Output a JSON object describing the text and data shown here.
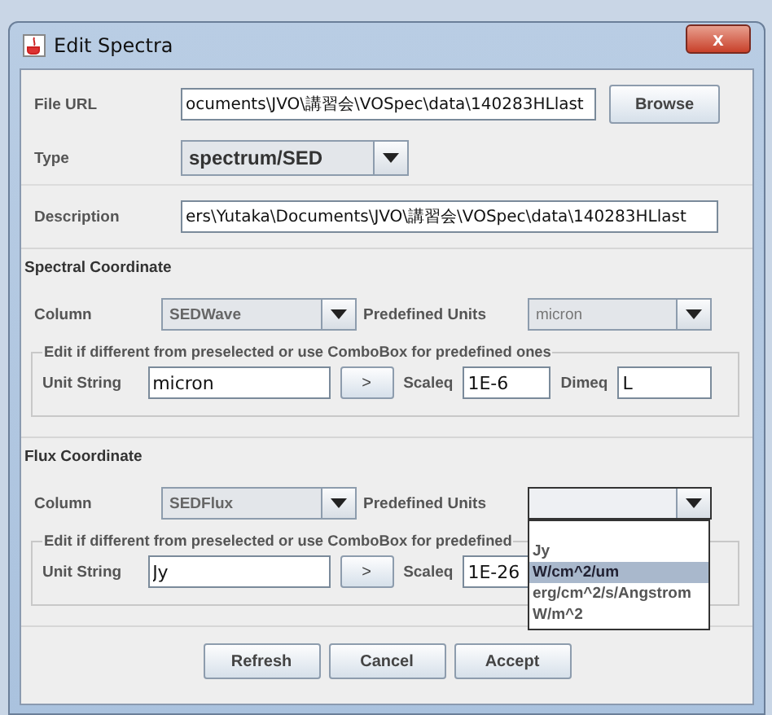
{
  "window": {
    "title": "Edit Spectra",
    "close": "x"
  },
  "file_url": {
    "label": "File URL",
    "value": "ocuments\\JVO\\講習会\\VOSpec\\data\\140283HLlast",
    "button": "Browse"
  },
  "type": {
    "label": "Type",
    "value": "spectrum/SED"
  },
  "description": {
    "label": "Description",
    "value": "ers\\Yutaka\\Documents\\JVO\\講習会\\VOSpec\\data\\140283HLlast"
  },
  "spectral_coordinate": {
    "title": "Spectral Coordinate",
    "column": {
      "label": "Column",
      "value": "SEDWave"
    },
    "predefined_units": {
      "label": "Predefined Units",
      "value": "micron",
      "expanded": false
    },
    "edit_group": {
      "title": "Edit if different from preselected or use ComboBox for predefined ones",
      "unit_string": {
        "label": "Unit String",
        "value": "micron"
      },
      "apply_button": ">",
      "scaleq": {
        "label": "Scaleq",
        "value": "1E-6"
      },
      "dimeq": {
        "label": "Dimeq",
        "value": "L"
      }
    }
  },
  "flux_coordinate": {
    "title": "Flux Coordinate",
    "column": {
      "label": "Column",
      "value": "SEDFlux"
    },
    "predefined_units": {
      "label": "Predefined Units",
      "expanded": true,
      "options": [
        {
          "label": "Jy",
          "selected": false
        },
        {
          "label": "W/cm^2/um",
          "selected": true
        },
        {
          "label": "erg/cm^2/s/Angstrom",
          "selected": false
        },
        {
          "label": "W/m^2",
          "selected": false
        }
      ]
    },
    "edit_group": {
      "title": "Edit if different from preselected or use ComboBox for predefined",
      "unit_string": {
        "label": "Unit String",
        "value": "Jy"
      },
      "apply_button": ">",
      "scaleq": {
        "label": "Scaleq",
        "value": "1E-26"
      }
    }
  },
  "buttons": [
    "Refresh",
    "Cancel",
    "Accept"
  ]
}
